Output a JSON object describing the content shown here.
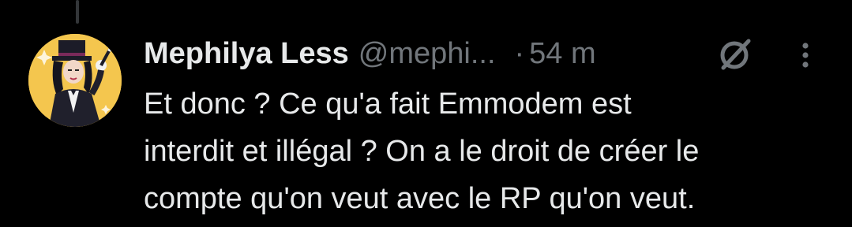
{
  "tweet": {
    "author_name": "Mephilya Less",
    "author_handle": "@mephi...",
    "time_separator": "·",
    "timestamp": "54 m",
    "text_lines": [
      "Et donc ? Ce qu'a fait Emmodem est",
      "interdit et illégal ? On a le droit de créer le",
      "compte qu'on veut avec le RP qu'on veut."
    ]
  },
  "icons": {
    "grok": "grok-icon",
    "more": "more-options-icon"
  },
  "colors": {
    "background": "#000000",
    "primary_text": "#e7e9ea",
    "secondary_text": "#71767b",
    "avatar_bg": "#f4c64e"
  }
}
